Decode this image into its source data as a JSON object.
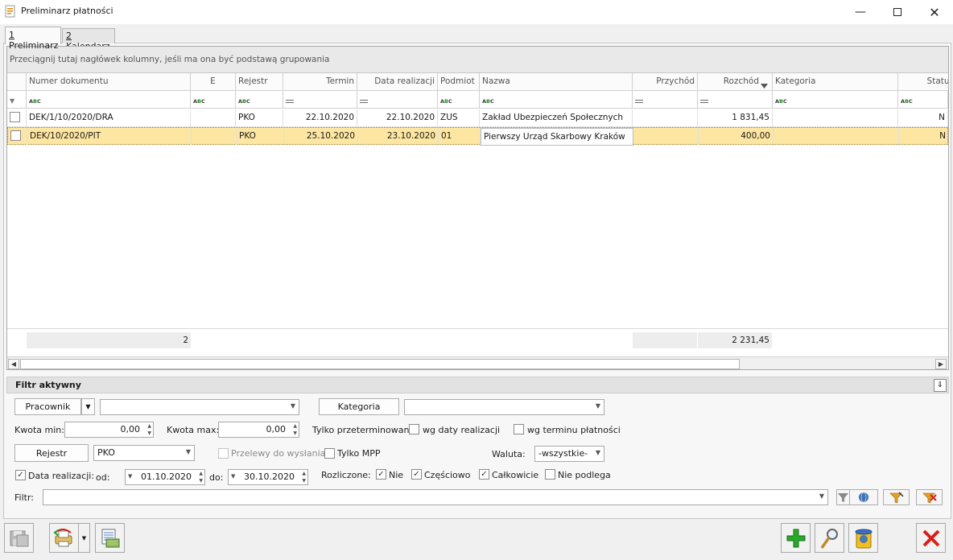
{
  "window": {
    "title": "Preliminarz płatności"
  },
  "tabs": [
    {
      "hotkey": "1",
      "label": " Preliminarz"
    },
    {
      "hotkey": "2",
      "label": " Kalendarz"
    }
  ],
  "grid": {
    "group_hint": "Przeciągnij tutaj nagłówek kolumny, jeśli ma ona być podstawą grupowania",
    "columns": [
      "Numer dokumentu",
      "E",
      "Rejestr",
      "Termin",
      "Data realizacji",
      "Podmiot",
      "Nazwa",
      "Przychód",
      "Rozchód",
      "Kategoria",
      "Status"
    ],
    "sort_column": "Rozchód",
    "rows": [
      {
        "numer": "DEK/1/10/2020/DRA",
        "e": "",
        "rejestr": "PKO",
        "termin": "22.10.2020",
        "data_realizacji": "22.10.2020",
        "podmiot": "ZUS",
        "nazwa": "Zakład Ubezpieczeń Społecznych",
        "przychod": "",
        "rozchod": "1 831,45",
        "kategoria": "",
        "status": "N",
        "selected": false
      },
      {
        "numer": "DEK/10/2020/PIT",
        "e": "",
        "rejestr": "PKO",
        "termin": "25.10.2020",
        "data_realizacji": "23.10.2020",
        "podmiot": "01",
        "nazwa": "Pierwszy Urząd Skarbowy Kraków",
        "przychod": "",
        "rozchod": "400,00",
        "kategoria": "",
        "status": "N",
        "selected": true
      }
    ],
    "summary": {
      "count": "2",
      "rozchod_total": "2 231,45"
    }
  },
  "filter": {
    "header": "Filtr aktywny",
    "pracownik_button": "Pracownik",
    "pracownik_value": "",
    "kategoria_button": "Kategoria",
    "kategoria_value": "",
    "kwota_min_label": "Kwota min:",
    "kwota_min_value": "0,00",
    "kwota_max_label": "Kwota max:",
    "kwota_max_value": "0,00",
    "tylko_przeterminowane_label": "Tylko przeterminowane:",
    "wg_daty_realizacji": "wg daty realizacji",
    "wg_terminu_platnosci": "wg terminu płatności",
    "rejestr_button": "Rejestr",
    "rejestr_value": "PKO",
    "przelewy_do_wyslania": "Przelewy do wysłania",
    "tylko_mpp": "Tylko MPP",
    "waluta_label": "Waluta:",
    "waluta_value": "-wszystkie-",
    "data_realizacji_label": "Data realizacji:",
    "od_label": "od:",
    "od_value": "01.10.2020",
    "do_label": "do:",
    "do_value": "30.10.2020",
    "rozliczone_label": "Rozliczone:",
    "nie_label": "Nie",
    "czesciowo_label": "Częściowo",
    "calkowicie_label": "Całkowicie",
    "nie_podlega_label": "Nie podlega",
    "filtr_label": "Filtr:",
    "filtr_value": ""
  }
}
